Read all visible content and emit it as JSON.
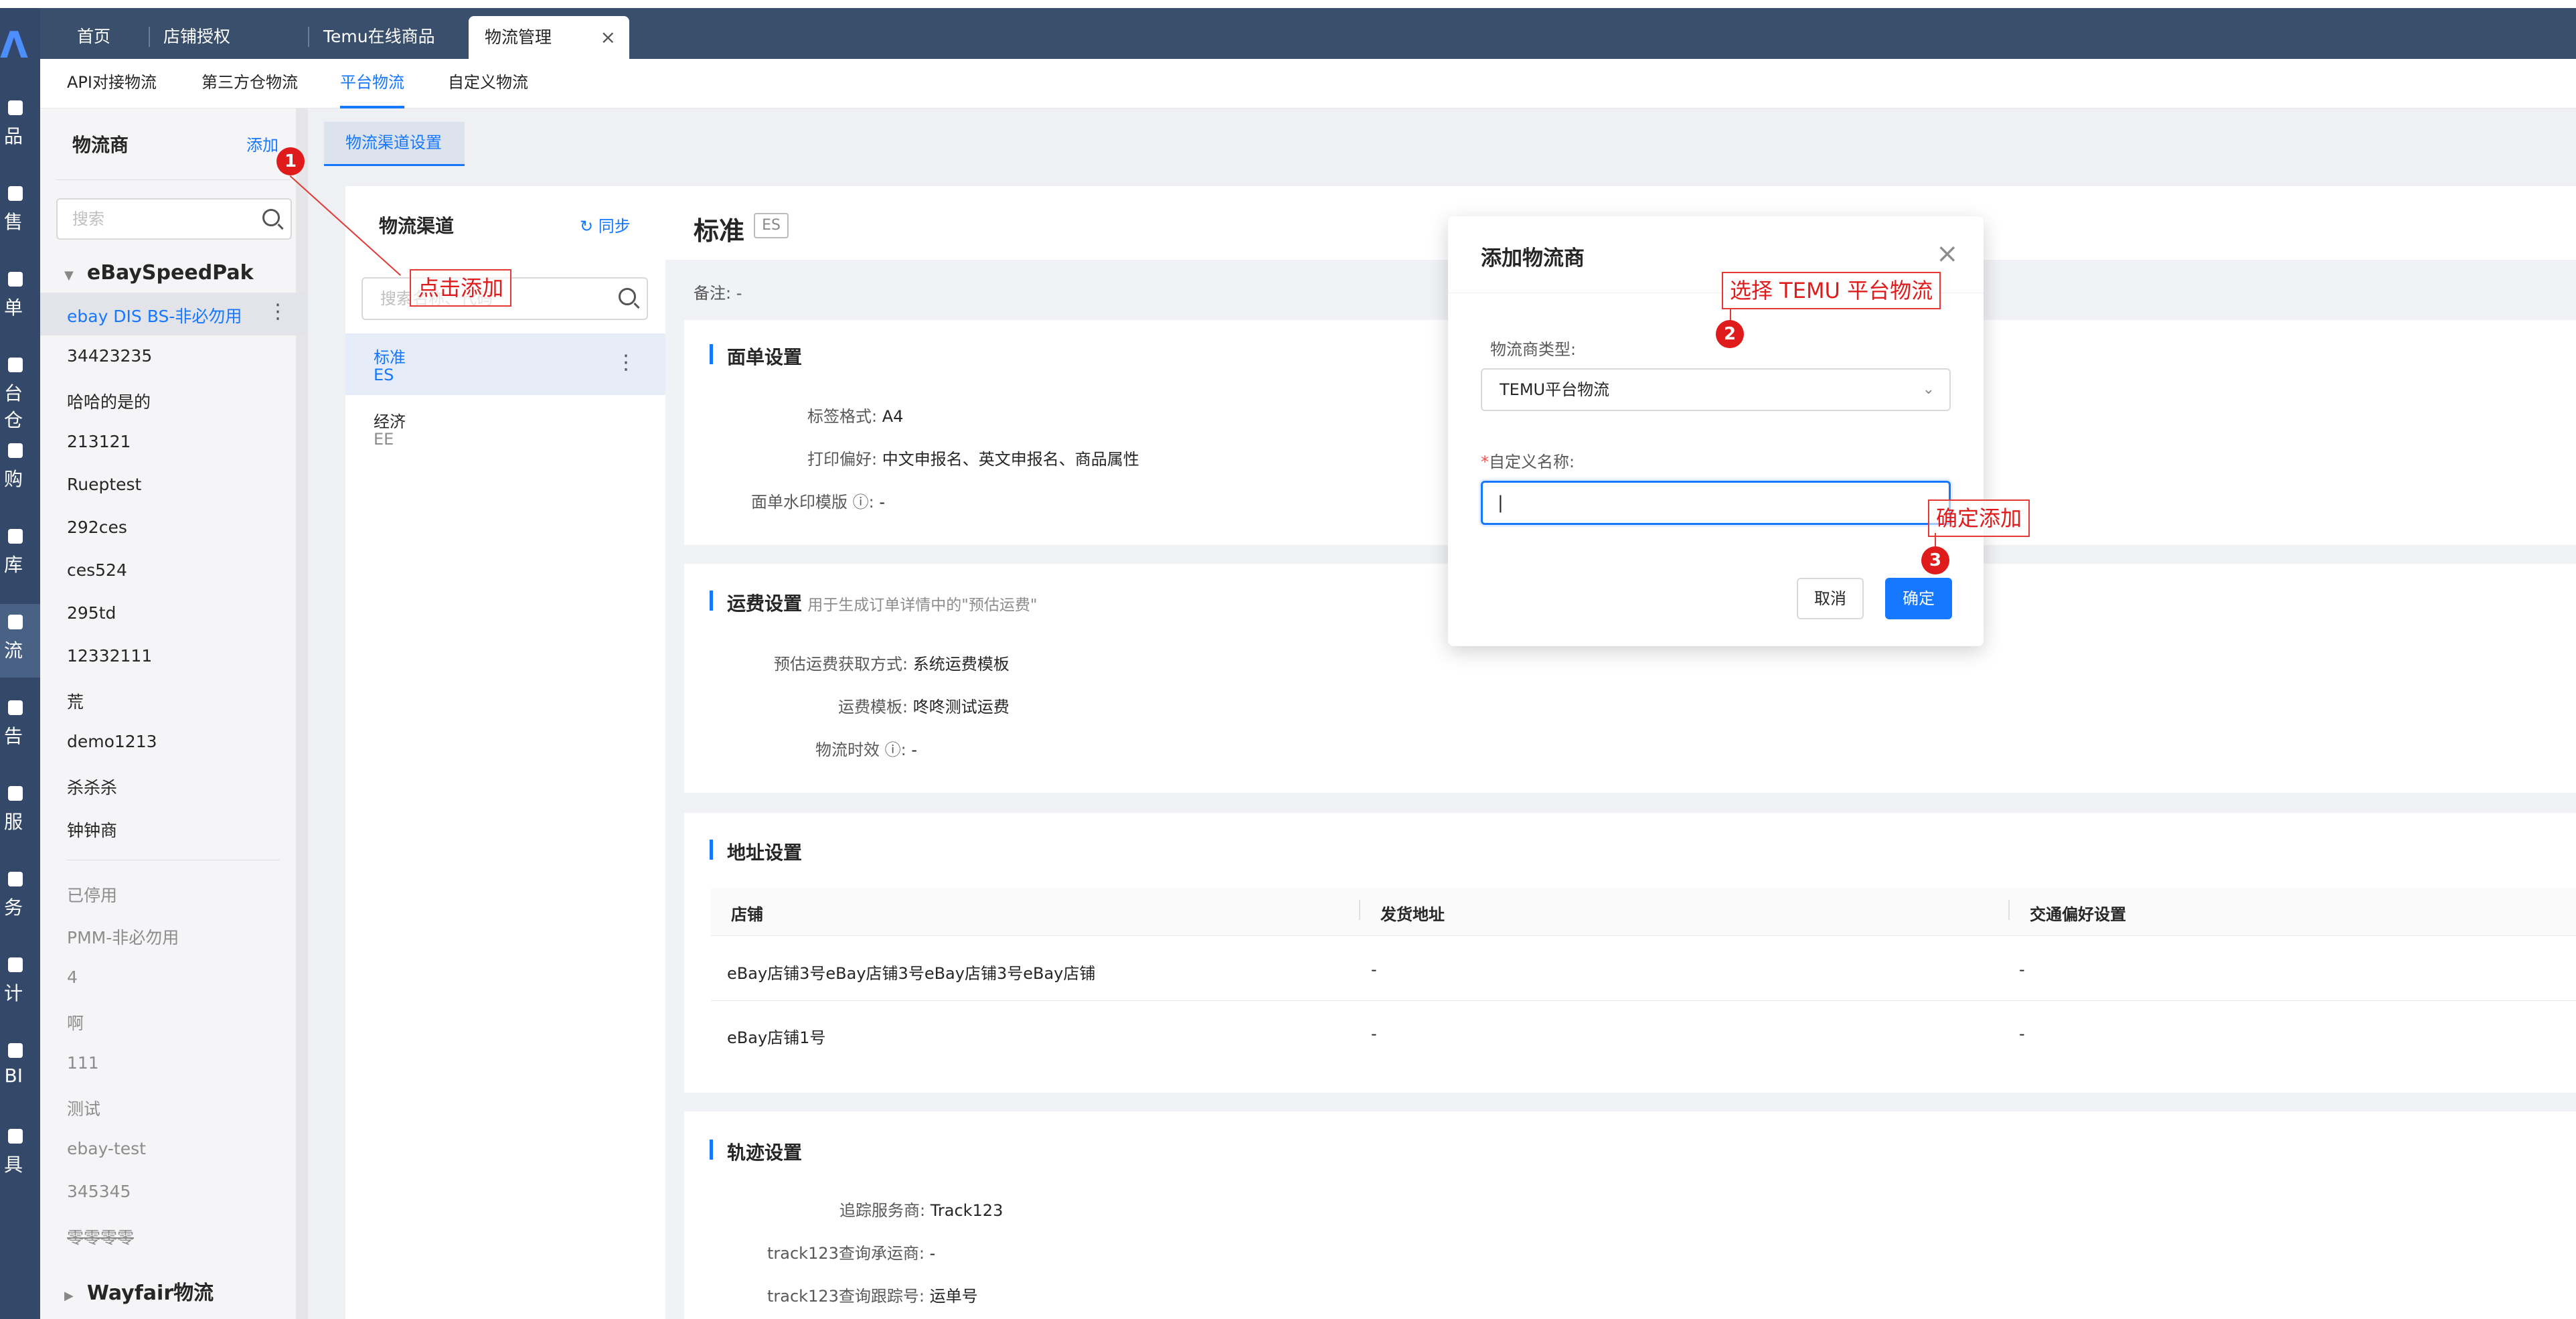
{
  "tabs": [
    {
      "label": "首页"
    },
    {
      "label": "店铺授权"
    },
    {
      "label": "Temu在线商品"
    },
    {
      "label": "物流管理",
      "close": "×"
    }
  ],
  "rail": [
    {
      "label": "品"
    },
    {
      "label": "售"
    },
    {
      "label": "单"
    },
    {
      "label": "台仓"
    },
    {
      "label": "购"
    },
    {
      "label": "库"
    },
    {
      "label": "流"
    },
    {
      "label": "告"
    },
    {
      "label": "服"
    },
    {
      "label": "务"
    },
    {
      "label": "计"
    },
    {
      "label": "BI"
    },
    {
      "label": "具"
    }
  ],
  "subnav": [
    {
      "label": "API对接物流"
    },
    {
      "label": "第三方仓物流"
    },
    {
      "label": "平台物流"
    },
    {
      "label": "自定义物流"
    }
  ],
  "providers": {
    "title": "物流商",
    "add": "添加",
    "search_placeholder": "搜索",
    "group1": "eBaySpeedPak",
    "items": [
      "ebay DIS BS-非必勿用",
      "34423235",
      "哈哈的是的",
      "213121",
      "Rueptest",
      "292ces",
      "ces524",
      "295td",
      "12332111",
      "荒",
      "demo1213",
      "杀杀杀",
      "钟钟商"
    ],
    "disabled_label": "已停用",
    "disabled": [
      "PMM-非必勿用",
      "4",
      "啊",
      "111",
      "测试",
      "ebay-test",
      "345345",
      "零零零零"
    ],
    "group2": "Wayfair物流"
  },
  "channel_tab": "物流渠道设置",
  "channels": {
    "title": "物流渠道",
    "sync": "同步",
    "search_placeholder": "搜索名称、代码",
    "items": [
      {
        "name": "标准",
        "code": "ES"
      },
      {
        "name": "经济",
        "code": "EE"
      }
    ]
  },
  "detail": {
    "title": "标准",
    "badge": "ES",
    "remark_label": "备注:",
    "remark_value": "-",
    "label_section": "面单设置",
    "label_format_k": "标签格式:",
    "label_format_v": "A4",
    "print_pref_k": "打印偏好:",
    "print_pref_v": "中文申报名、英文申报名、商品属性",
    "watermark_k": "面单水印模版",
    "watermark_v": "-",
    "freight_section": "运费设置",
    "freight_note": "用于生成订单详情中的\"预估运费\"",
    "freight_method_k": "预估运费获取方式:",
    "freight_method_v": "系统运费模板",
    "freight_tpl_k": "运费模板:",
    "freight_tpl_v": "咚咚测试运费",
    "aging_k": "物流时效",
    "aging_v": "-",
    "addr_section": "地址设置",
    "addr_cols": [
      "店铺",
      "发货地址",
      "交通偏好设置"
    ],
    "addr_rows": [
      [
        "eBay店铺3号eBay店铺3号eBay店铺3号eBay店铺",
        "-",
        "-"
      ],
      [
        "eBay店铺1号",
        "-",
        "-"
      ]
    ],
    "track_section": "轨迹设置",
    "track_svc_k": "追踪服务商:",
    "track_svc_v": "Track123",
    "track_carrier_k": "track123查询承运商:",
    "track_carrier_v": "-",
    "track_no_k": "track123查询跟踪号:",
    "track_no_v": "运单号"
  },
  "modal": {
    "title": "添加物流商",
    "close": "×",
    "type_label": "物流商类型:",
    "type_value": "TEMU平台物流",
    "name_label": "自定义名称:",
    "name_value": "|",
    "cancel": "取消",
    "ok": "确定"
  },
  "annotations": [
    {
      "num": "1",
      "text": "点击添加"
    },
    {
      "num": "2",
      "text": "选择 TEMU 平台物流"
    },
    {
      "num": "3",
      "text": "确定添加"
    }
  ]
}
